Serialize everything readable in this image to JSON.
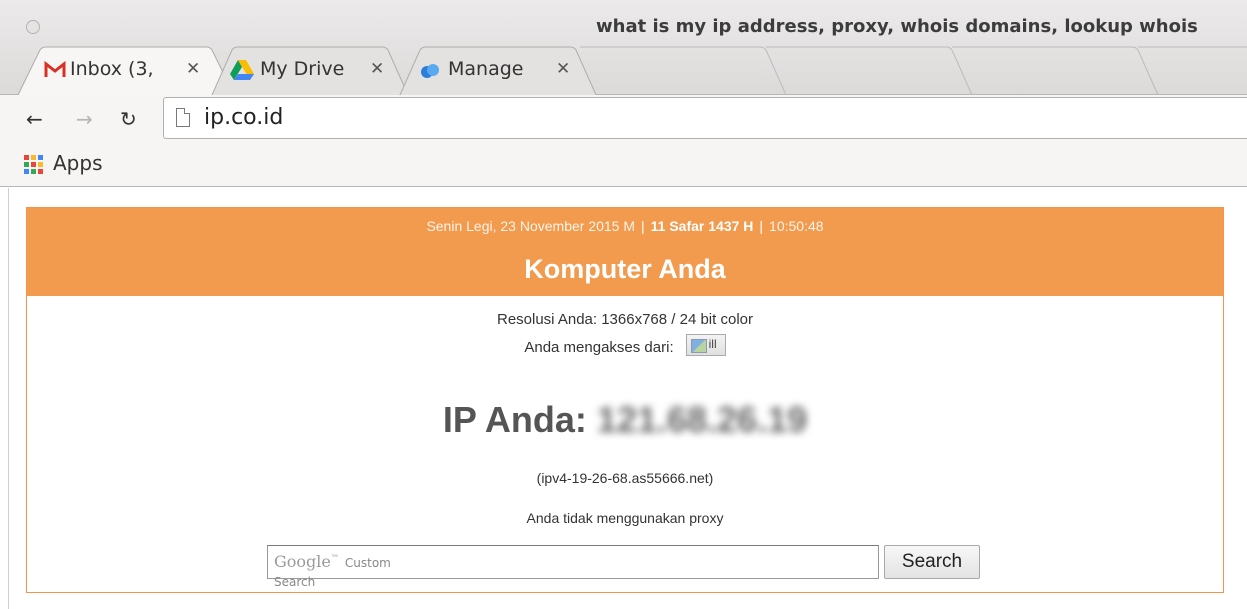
{
  "window": {
    "title": "what is my ip address, proxy, whois domains, lookup whois"
  },
  "tabs": [
    {
      "label": "Inbox (3,",
      "icon": "gmail-icon",
      "active": true
    },
    {
      "label": "My Drive",
      "icon": "google-drive-icon",
      "active": false
    },
    {
      "label": "Manage",
      "icon": "cloud-icon",
      "active": false
    }
  ],
  "toolbar": {
    "url": "ip.co.id",
    "back": "←",
    "forward": "→",
    "reload": "↻"
  },
  "bookmarks": {
    "apps_label": "Apps"
  },
  "page": {
    "date_gregorian": "Senin Legi, 23 November 2015 M",
    "date_hijri": "11 Safar 1437 H",
    "time": "10:50:48",
    "title": "Komputer Anda",
    "resolution": "Resolusi Anda: 1366x768 / 24 bit color",
    "access_from": "Anda mengakses dari:",
    "ip_label": "IP Anda:",
    "ip_value": "121.68.26.19",
    "hostname": "(ipv4-19-26-68.as55666.net)",
    "proxy_status": "Anda tidak menggunakan proxy",
    "search_brand": "Google",
    "search_brand_tm": "™",
    "search_brand_sub": "Custom Search",
    "search_button": "Search"
  },
  "colors": {
    "header": "#f29a4e",
    "border": "#f0964a"
  }
}
